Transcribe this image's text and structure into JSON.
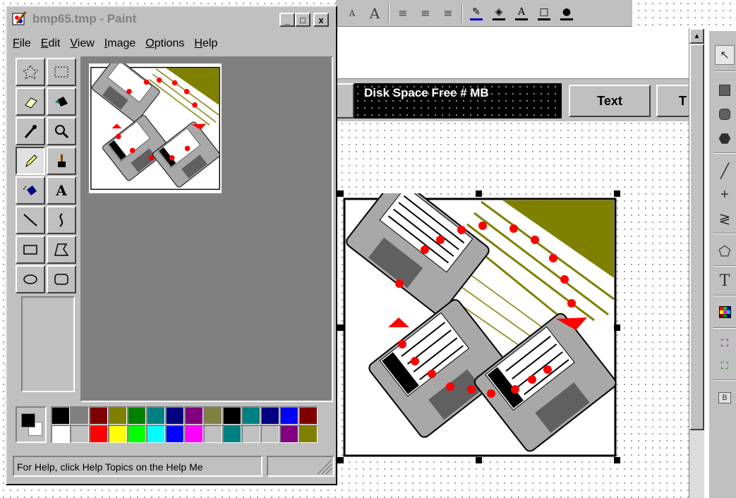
{
  "paint": {
    "title": "bmp65.tmp - Paint",
    "caption_buttons": {
      "minimize": "_",
      "maximize": "□",
      "close": "x"
    },
    "menu": [
      {
        "acc": "F",
        "rest": "ile"
      },
      {
        "acc": "E",
        "rest": "dit"
      },
      {
        "acc": "V",
        "rest": "iew"
      },
      {
        "acc": "I",
        "rest": "mage"
      },
      {
        "acc": "O",
        "rest": "ptions"
      },
      {
        "acc": "H",
        "rest": "elp"
      }
    ],
    "tools": [
      {
        "name": "free-form-select-tool",
        "icon": "free-form-select-icon"
      },
      {
        "name": "rectangle-select-tool",
        "icon": "rectangle-select-icon"
      },
      {
        "name": "eraser-tool",
        "icon": "eraser-icon"
      },
      {
        "name": "fill-bucket-tool",
        "icon": "fill-bucket-icon"
      },
      {
        "name": "pick-color-tool",
        "icon": "eyedropper-icon"
      },
      {
        "name": "magnifier-tool",
        "icon": "magnifier-icon"
      },
      {
        "name": "pencil-tool",
        "icon": "pencil-icon",
        "selected": true
      },
      {
        "name": "brush-tool",
        "icon": "brush-icon"
      },
      {
        "name": "airbrush-tool",
        "icon": "airbrush-icon"
      },
      {
        "name": "text-tool",
        "icon": "text-icon",
        "glyph": "A"
      },
      {
        "name": "line-tool",
        "icon": "line-icon"
      },
      {
        "name": "curve-tool",
        "icon": "curve-icon"
      },
      {
        "name": "rectangle-tool",
        "icon": "rectangle-icon"
      },
      {
        "name": "polygon-tool",
        "icon": "polygon-icon"
      },
      {
        "name": "ellipse-tool",
        "icon": "ellipse-icon"
      },
      {
        "name": "rounded-rectangle-tool",
        "icon": "rounded-rectangle-icon"
      }
    ],
    "colors": {
      "foreground": "#000000",
      "background": "#ffffff",
      "palette_row1": [
        "#000000",
        "#808080",
        "#800000",
        "#808000",
        "#008000",
        "#008080",
        "#000080",
        "#800080",
        "#808040",
        "#000000",
        "#008080",
        "#000080",
        "#0000ff",
        "#800000"
      ],
      "palette_row2": [
        "#ffffff",
        "#c0c0c0",
        "#ff0000",
        "#ffff00",
        "#00ff00",
        "#00ffff",
        "#0000ff",
        "#ff00ff",
        "#c0c0c0",
        "#008080",
        "#c0c0c0",
        "#c0c0c0",
        "#800080",
        "#808000"
      ]
    },
    "status": "For Help, click Help Topics on the Help Me"
  },
  "report": {
    "field_label": "Disk Space Free # MB",
    "button_text": "Text",
    "button_text_partial": "T"
  },
  "toolbox_icons": [
    "pointer-icon",
    "rectangle-icon",
    "rounded-rectangle-icon",
    "ellipse-icon",
    "line-icon",
    "crosshair-icon",
    "zigzag-icon",
    "polygon-icon",
    "text-icon",
    "picture-icon",
    "bitmap-icon",
    "ole-object-icon",
    "button-icon"
  ],
  "toolbox_labels": {
    "text": "T",
    "button": "B"
  },
  "image_colors": {
    "olive": "#808000",
    "red": "#ff0000",
    "disk_gray": "#a8a8a8",
    "dark_gray": "#606060"
  }
}
